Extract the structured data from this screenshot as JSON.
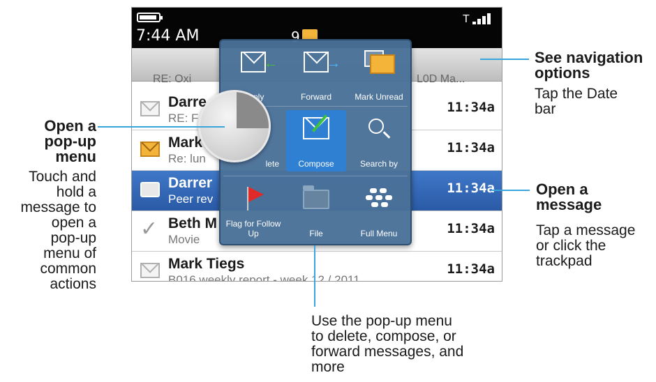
{
  "device": {
    "status": {
      "time": "7:44 AM",
      "message_count": "9"
    },
    "datebar": {
      "left_text": "RE: Oxi",
      "right_text": "L0D Ma..."
    },
    "messages": [
      {
        "sender": "Darre",
        "subject": "RE: F",
        "time": "11:34a",
        "icon": "read-envelope-icon",
        "selected": false
      },
      {
        "sender": "Mark",
        "subject": "Re: lun",
        "time": "11:34a",
        "icon": "unread-envelope-icon",
        "selected": false
      },
      {
        "sender": "Darrer",
        "subject": "Peer rev",
        "time": "11:34a",
        "icon": "attachment-envelope-icon",
        "selected": true
      },
      {
        "sender": "Beth M",
        "subject": "Movie",
        "time": "11:34a",
        "icon": "sent-check-icon",
        "selected": false
      },
      {
        "sender": "Mark Tiegs",
        "subject": "B016 weekly report - week 12 / 2011",
        "time": "11:34a",
        "icon": "read-envelope-icon",
        "selected": false
      }
    ],
    "popup_menu": {
      "items": [
        {
          "label": "Reply",
          "icon": "reply-icon"
        },
        {
          "label": "Forward",
          "icon": "forward-icon"
        },
        {
          "label": "Mark Unread",
          "icon": "mark-unread-icon"
        },
        {
          "label": "Delete",
          "visible_label": "lete",
          "icon": "delete-icon"
        },
        {
          "label": "Compose",
          "icon": "compose-icon"
        },
        {
          "label": "Search by",
          "icon": "search-icon"
        },
        {
          "label": "Flag for Follow Up",
          "icon": "flag-icon"
        },
        {
          "label": "File",
          "icon": "folder-icon"
        },
        {
          "label": "Full Menu",
          "icon": "blackberry-menu-icon"
        }
      ]
    }
  },
  "callouts": {
    "left": {
      "heading": [
        "Open a",
        "pop-up",
        "menu"
      ],
      "body": [
        "Touch and",
        "hold a",
        "message to",
        "open a",
        "pop-up",
        "menu of",
        "common",
        "actions"
      ]
    },
    "top_right": {
      "heading": [
        "See navigation",
        "options"
      ],
      "body": [
        "Tap the Date",
        "bar"
      ]
    },
    "mid_right": {
      "heading": [
        "Open a",
        "message"
      ],
      "body": [
        "Tap a message",
        "or click the",
        "trackpad"
      ]
    },
    "bottom": {
      "body": [
        "Use the pop-up menu",
        "to delete, compose, or",
        "forward messages, and",
        "more"
      ]
    }
  },
  "colors": {
    "callout_line": "#3aa5dc",
    "selected_row": "#2f64b3",
    "popup_bg": "#4a7098",
    "unread_envelope": "#f4b43a"
  }
}
